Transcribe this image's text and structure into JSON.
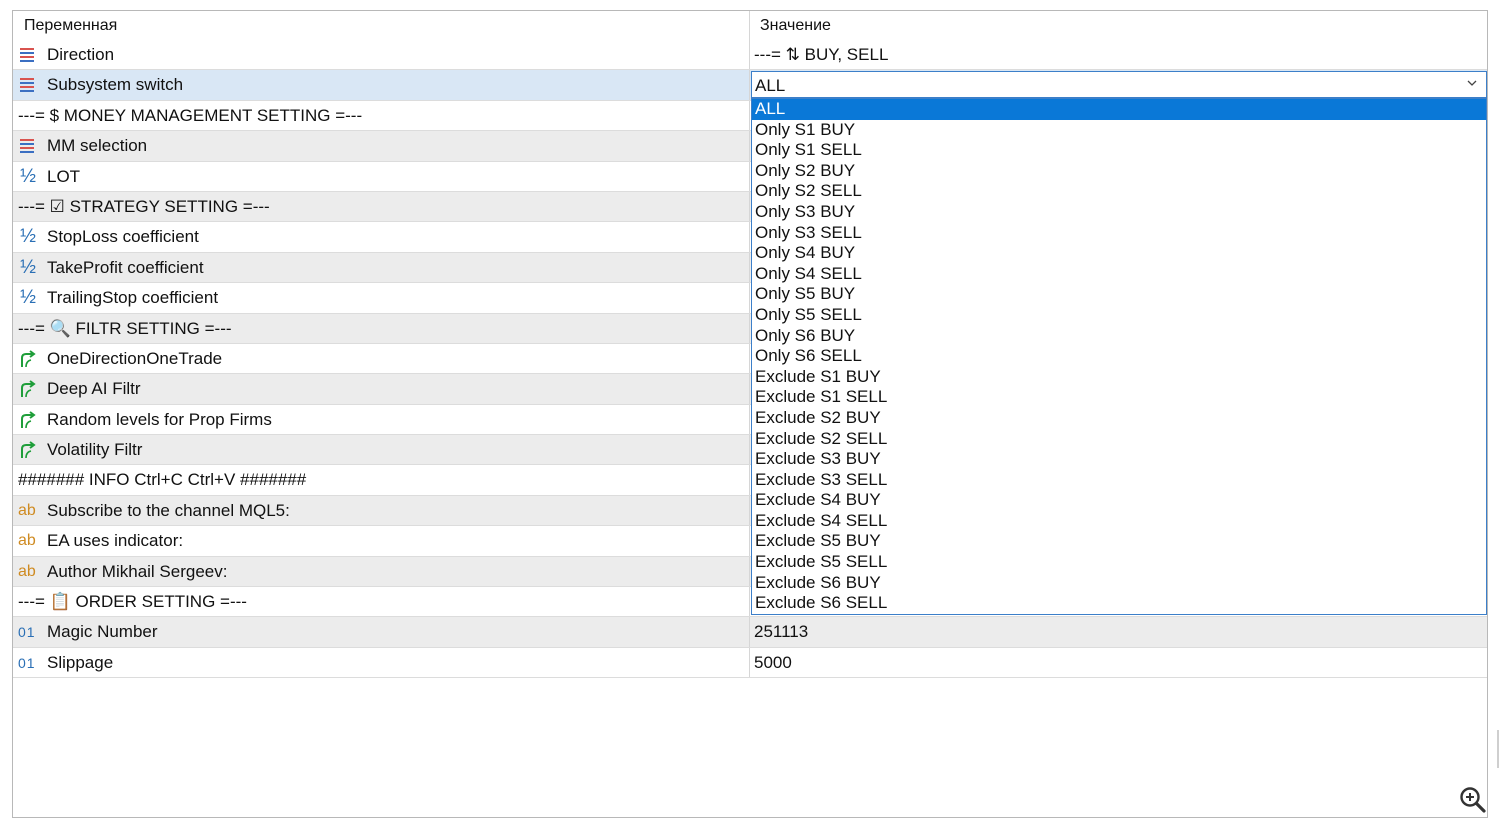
{
  "header": {
    "name_col": "Переменная",
    "value_col": "Значение"
  },
  "rows": [
    {
      "icon": "enum-icon",
      "name": "Direction",
      "value": "---= ⇅ BUY, SELL"
    },
    {
      "icon": "enum-icon",
      "name": "Subsystem switch",
      "value": "ALL"
    },
    {
      "icon": "",
      "name": "---= $ MONEY MANAGEMENT SETTING =---",
      "value": ""
    },
    {
      "icon": "enum-icon",
      "name": "MM selection",
      "value": ""
    },
    {
      "icon": "fraction-icon",
      "name": "LOT",
      "value": ""
    },
    {
      "icon": "",
      "name": "---= ☑ STRATEGY SETTING =---",
      "value": ""
    },
    {
      "icon": "fraction-icon",
      "name": "StopLoss coefficient",
      "value": ""
    },
    {
      "icon": "fraction-icon",
      "name": "TakeProfit coefficient",
      "value": ""
    },
    {
      "icon": "fraction-icon",
      "name": "TrailingStop coefficient",
      "value": ""
    },
    {
      "icon": "",
      "name": "---= 🔍 FILTR SETTING =---",
      "value": ""
    },
    {
      "icon": "bool-icon",
      "name": "OneDirectionOneTrade",
      "value": ""
    },
    {
      "icon": "bool-icon",
      "name": "Deep AI Filtr",
      "value": ""
    },
    {
      "icon": "bool-icon",
      "name": "Random levels for Prop Firms",
      "value": ""
    },
    {
      "icon": "bool-icon",
      "name": "Volatility Filtr",
      "value": ""
    },
    {
      "icon": "",
      "name": "####### INFO Ctrl+C Ctrl+V #######",
      "value": ""
    },
    {
      "icon": "string-icon",
      "name": "Subscribe to the channel MQL5:",
      "value": ""
    },
    {
      "icon": "string-icon",
      "name": "EA uses indicator:",
      "value": ""
    },
    {
      "icon": "string-icon",
      "name": "Author Mikhail Sergeev:",
      "value": ""
    },
    {
      "icon": "",
      "name": "---= 📋 ORDER SETTING =---",
      "value": ""
    },
    {
      "icon": "integer-icon",
      "name": "Magic Number",
      "value": "251113"
    },
    {
      "icon": "integer-icon",
      "name": "Slippage",
      "value": "5000"
    }
  ],
  "icon_text": {
    "fraction": "½",
    "string": "ab",
    "integer": "01"
  },
  "combo": {
    "selected": "ALL"
  },
  "dropdown_options": [
    "ALL",
    "Only S1 BUY",
    "Only S1 SELL",
    "Only S2 BUY",
    "Only S2 SELL",
    "Only S3 BUY",
    "Only S3 SELL",
    "Only S4 BUY",
    "Only S4 SELL",
    "Only S5 BUY",
    "Only S5 SELL",
    "Only S6 BUY",
    "Only S6 SELL",
    "Exclude S1 BUY",
    "Exclude S1 SELL",
    "Exclude S2 BUY",
    "Exclude S2 SELL",
    "Exclude S3 BUY",
    "Exclude S3 SELL",
    "Exclude S4 BUY",
    "Exclude S4 SELL",
    "Exclude S5 BUY",
    "Exclude S5 SELL",
    "Exclude S6 BUY",
    "Exclude S6 SELL"
  ],
  "colors": {
    "accent": "#0a78d7",
    "row_shade": "#ececec",
    "row_selected": "#d9e7f5",
    "combo_border": "#3c7fc9"
  }
}
